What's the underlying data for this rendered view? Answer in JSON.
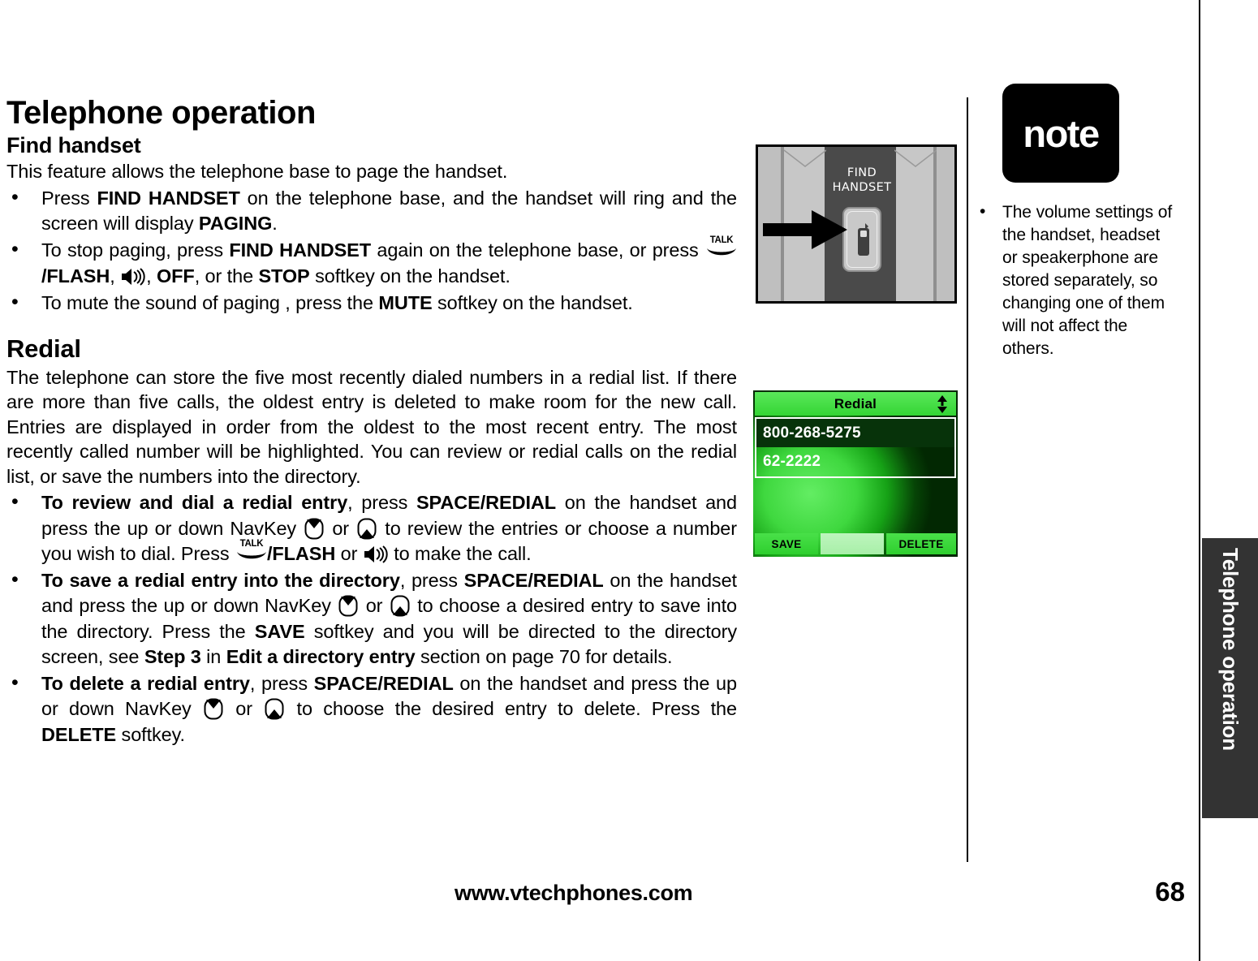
{
  "header": {
    "page_title": "Telephone operation"
  },
  "sections": {
    "find_handset": {
      "heading": "Find handset",
      "intro": "This feature allows the telephone base to page the handset.",
      "bullets": {
        "b1_a": "Press ",
        "b1_b": "FIND HANDSET",
        "b1_c": " on the telephone base, and the handset will ring and the screen will display ",
        "b1_d": "PAGING",
        "b1_e": ".",
        "b2_a": "To stop paging, press ",
        "b2_b": "FIND HANDSET",
        "b2_c": " again on the telephone base, or press ",
        "b2_d": "/FLASH",
        "b2_e": ", ",
        "b2_f": ", ",
        "b2_g": "OFF",
        "b2_h": ", or the ",
        "b2_i": "STOP",
        "b2_j": " softkey on the handset.",
        "b3_a": "To mute the sound of paging , press the ",
        "b3_b": "MUTE",
        "b3_c": " softkey on the handset."
      }
    },
    "redial": {
      "heading": "Redial",
      "intro": "The telephone can store the five most recently dialed numbers in a redial list. If there are more than five calls, the oldest entry is deleted to make room for the new call. Entries are displayed in order from the oldest to the most recent entry. The most recently called number will be highlighted. You can review or redial calls on the redial list, or save the numbers into the directory.",
      "bullets": {
        "r1_a": "To review and dial a redial entry",
        "r1_b": ", press ",
        "r1_c": "SPACE/REDIAL",
        "r1_d": " on the handset and press the up or down NavKey ",
        "r1_e": " or ",
        "r1_f": " to review the entries or choose a number you wish to dial. Press ",
        "r1_g": "/FLASH",
        "r1_h": " or ",
        "r1_i": " to make the call.",
        "r2_a": "To save a redial entry into the directory",
        "r2_b": ", press ",
        "r2_c": "SPACE/REDIAL",
        "r2_d": " on the handset and press the up or down NavKey ",
        "r2_e": " or ",
        "r2_f": " to choose a desired entry to save into the directory. Press the ",
        "r2_g": "SAVE",
        "r2_h": " softkey and you will be directed to the directory screen, see ",
        "r2_i": "Step 3",
        "r2_j": " in ",
        "r2_k": "Edit a directory entry",
        "r2_l": " section on page 70 for details.",
        "r3_a": "To delete a redial entry",
        "r3_b": ", press ",
        "r3_c": "SPACE/REDIAL",
        "r3_d": " on the handset and press the up or down NavKey ",
        "r3_e": " or ",
        "r3_f": " to choose the desired entry to delete. Press the ",
        "r3_g": "DELETE",
        "r3_h": " softkey."
      }
    }
  },
  "figures": {
    "telephone_base": {
      "button_label_line1": "FIND",
      "button_label_line2": "HANDSET",
      "arrow_icon": "right-arrow-icon",
      "handset_icon": "handset-icon"
    },
    "lcd": {
      "title": "Redial",
      "scroll_icon": "up-down-scroll-icon",
      "entries": [
        {
          "number": "800-268-5275",
          "selected": true
        },
        {
          "number": "62-2222",
          "selected": false
        }
      ],
      "softkeys": {
        "left": "SAVE",
        "middle": "",
        "right": "DELETE"
      },
      "colors": {
        "screen_bright": "#3fd83f",
        "screen_dark": "#022802",
        "selected_row": "#07330a",
        "softkey": "#2ecf2e",
        "softkey_middle": "#a8efa8"
      }
    }
  },
  "note": {
    "badge_label": "note",
    "items": [
      "The volume settings of the handset, headset or speakerphone are stored separately, so changing one of them will not affect the others."
    ]
  },
  "side_tab": {
    "label": "Telephone operation",
    "color": "#333333"
  },
  "footer": {
    "url": "www.vtechphones.com",
    "page_number": "68"
  }
}
